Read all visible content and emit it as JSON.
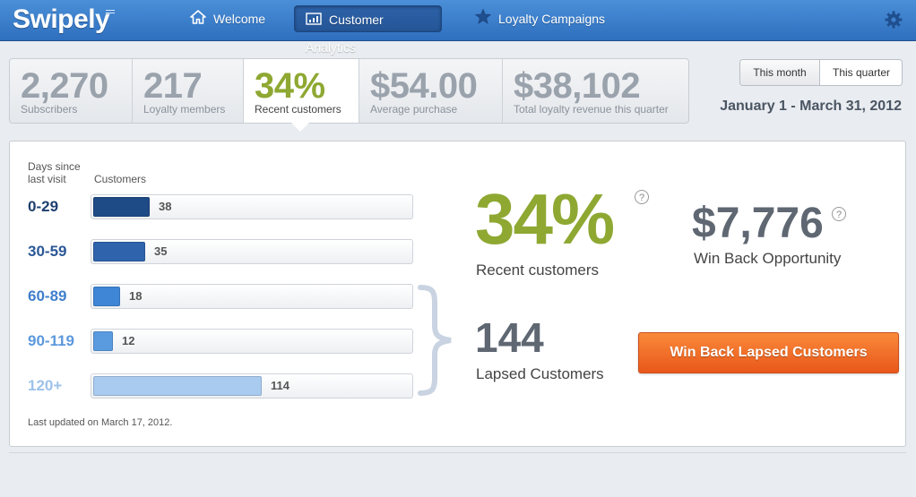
{
  "app": {
    "logo": "Swipely"
  },
  "nav": {
    "welcome": "Welcome",
    "analytics": "Customer Analytics",
    "loyalty": "Loyalty Campaigns"
  },
  "stats": [
    {
      "value": "2,270",
      "label": "Subscribers"
    },
    {
      "value": "217",
      "label": "Loyalty members"
    },
    {
      "value": "34%",
      "label": "Recent customers"
    },
    {
      "value": "$54.00",
      "label": "Average purchase"
    },
    {
      "value": "$38,102",
      "label": "Total loyalty revenue this quarter"
    }
  ],
  "period": {
    "month": "This month",
    "quarter": "This quarter",
    "selected": "This quarter",
    "range": "January 1 - March 31, 2012"
  },
  "table": {
    "col_days": "Days since last visit",
    "col_customers": "Customers",
    "max": 114,
    "rows": [
      {
        "label": "0-29",
        "count": 38,
        "count_text": "38",
        "color": "#1e4a86",
        "label_color": "#1e3f6f"
      },
      {
        "label": "30-59",
        "count": 35,
        "count_text": "35",
        "color": "#2f63ab",
        "label_color": "#2a5796"
      },
      {
        "label": "60-89",
        "count": 18,
        "count_text": "18",
        "color": "#3f86d6",
        "label_color": "#3f7fcc"
      },
      {
        "label": "90-119",
        "count": 12,
        "count_text": "12",
        "color": "#5a9be0",
        "label_color": "#5b98dc"
      },
      {
        "label": "120+",
        "count": 114,
        "count_text": "114",
        "color": "#a9cbf0",
        "label_color": "#9dc2ea"
      }
    ]
  },
  "summary": {
    "recent_pct": "34%",
    "recent_label": "Recent customers",
    "winback_value": "$7,776",
    "winback_label": "Win Back Opportunity",
    "lapsed_value": "144",
    "lapsed_label": "Lapsed Customers",
    "button": "Win Back Lapsed Customers",
    "help": "?"
  },
  "footer": {
    "updated": "Last updated on March 17, 2012."
  },
  "colors": {
    "accent_green": "#8ea832",
    "nav_blue": "#2f6fbe",
    "button_orange": "#f07a2c"
  }
}
